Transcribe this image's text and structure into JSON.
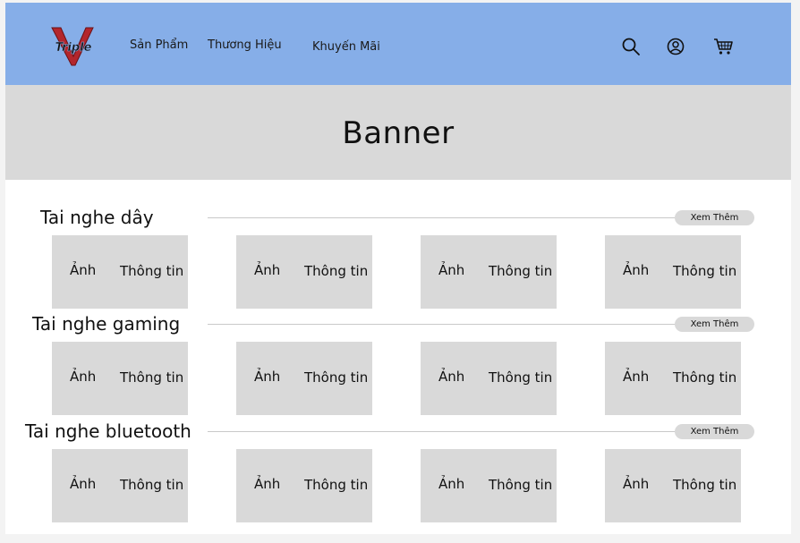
{
  "header": {
    "logo": {
      "letter": "V",
      "word": "Triple",
      "icon": "triple-v-logo"
    },
    "nav": [
      {
        "label": "Sản Phẩm"
      },
      {
        "label": "Thương Hiệu"
      },
      {
        "label": "Khuyến Mãi"
      }
    ],
    "icons": [
      "search-icon",
      "user-icon",
      "cart-icon"
    ],
    "background_color": "#86aee8"
  },
  "banner": {
    "text": "Banner"
  },
  "sections": [
    {
      "title": "Tai nghe dây",
      "more_label": "Xem Thêm",
      "cards": [
        {
          "image_label": "Ảnh",
          "info_label": "Thông tin"
        },
        {
          "image_label": "Ảnh",
          "info_label": "Thông tin"
        },
        {
          "image_label": "Ảnh",
          "info_label": "Thông tin"
        },
        {
          "image_label": "Ảnh",
          "info_label": "Thông tin"
        }
      ]
    },
    {
      "title": "Tai nghe gaming",
      "more_label": "Xem Thêm",
      "cards": [
        {
          "image_label": "Ảnh",
          "info_label": "Thông tin"
        },
        {
          "image_label": "Ảnh",
          "info_label": "Thông tin"
        },
        {
          "image_label": "Ảnh",
          "info_label": "Thông tin"
        },
        {
          "image_label": "Ảnh",
          "info_label": "Thông tin"
        }
      ]
    },
    {
      "title": "Tai nghe bluetooth",
      "more_label": "Xem Thêm",
      "cards": [
        {
          "image_label": "Ảnh",
          "info_label": "Thông tin"
        },
        {
          "image_label": "Ảnh",
          "info_label": "Thông tin"
        },
        {
          "image_label": "Ảnh",
          "info_label": "Thông tin"
        },
        {
          "image_label": "Ảnh",
          "info_label": "Thông tin"
        }
      ]
    }
  ]
}
